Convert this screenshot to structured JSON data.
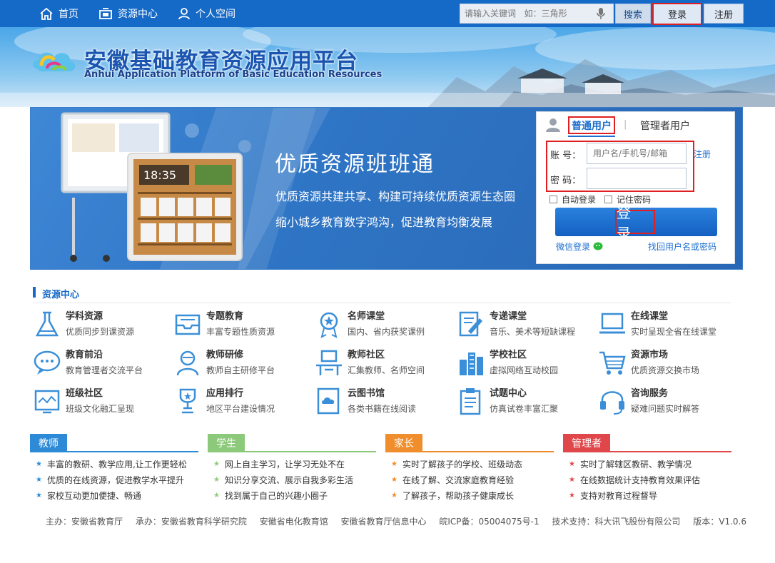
{
  "topnav": {
    "items": [
      {
        "label": "首页",
        "icon": "home-icon"
      },
      {
        "label": "资源中心",
        "icon": "monitor-icon"
      },
      {
        "label": "个人空间",
        "icon": "user-icon"
      }
    ],
    "search_placeholder": "请输入关键词   如：三角形",
    "search_label": "搜索",
    "login_label": "登录",
    "register_label": "注册"
  },
  "banner": {
    "title": "安徽基础教育资源应用平台",
    "subtitle": "Anhui Application Platform of Basic Education Resources"
  },
  "hero": {
    "slogan": "优质资源班班通",
    "line1": "优质资源共建共享、构建可持续优质资源生态圈",
    "line2": "缩小城乡教育数字鸿沟，促进教育均衡发展",
    "clock": "18:35"
  },
  "login": {
    "tab_normal": "普通用户",
    "tab_separator": "|",
    "tab_admin": "管理者用户",
    "account_label": "账  号：",
    "account_placeholder": "用户名/手机号/邮箱",
    "password_label": "密  码：",
    "register_link": "注册",
    "auto_login": "自动登录",
    "remember_pwd": "记住密码",
    "submit": "登 录",
    "wechat_login": "微信登录",
    "forgot": "找回用户名或密码"
  },
  "resource_center": {
    "title": "资源中心",
    "items": [
      {
        "title": "学科资源",
        "desc": "优质同步到课资源",
        "icon": "flask-icon"
      },
      {
        "title": "专题教育",
        "desc": "丰富专题性质资源",
        "icon": "inbox-icon"
      },
      {
        "title": "名师课堂",
        "desc": "国内、省内获奖课例",
        "icon": "medal-icon"
      },
      {
        "title": "专递课堂",
        "desc": "音乐、美术等短缺课程",
        "icon": "edit-icon"
      },
      {
        "title": "在线课堂",
        "desc": "实时呈现全省在线课堂",
        "icon": "laptop-icon"
      },
      {
        "title": "教育前沿",
        "desc": "教育管理者交流平台",
        "icon": "chat-icon"
      },
      {
        "title": "教师研修",
        "desc": "教师自主研修平台",
        "icon": "teacher-icon"
      },
      {
        "title": "教师社区",
        "desc": "汇集教师、名师空间",
        "icon": "desk-icon"
      },
      {
        "title": "学校社区",
        "desc": "虚拟网络互动校园",
        "icon": "buildings-icon"
      },
      {
        "title": "资源市场",
        "desc": "优质资源交换市场",
        "icon": "cart-icon"
      },
      {
        "title": "班级社区",
        "desc": "班级文化融汇呈现",
        "icon": "board-icon"
      },
      {
        "title": "应用排行",
        "desc": "地区平台建设情况",
        "icon": "trophy-icon"
      },
      {
        "title": "云图书馆",
        "desc": "各类书籍在线阅读",
        "icon": "cloud-book-icon"
      },
      {
        "title": "试题中心",
        "desc": "仿真试卷丰富汇聚",
        "icon": "clipboard-icon"
      },
      {
        "title": "咨询服务",
        "desc": "疑难问题实时解答",
        "icon": "headset-icon"
      }
    ]
  },
  "roles": [
    {
      "name": "教师",
      "color": "#2d8ad6",
      "star_color": "#2d8ad6",
      "lines": [
        "丰富的教研、教学应用,让工作更轻松",
        "优质的在线资源，促进教学水平提升",
        "家校互动更加便捷、畅通"
      ]
    },
    {
      "name": "学生",
      "color": "#8cc97a",
      "star_color": "#8cc97a",
      "lines": [
        "网上自主学习，让学习无处不在",
        "知识分享交流、展示自我多彩生活",
        "找到属于自己的兴趣小圈子"
      ]
    },
    {
      "name": "家长",
      "color": "#f08d2c",
      "star_color": "#f08d2c",
      "lines": [
        "实时了解孩子的学校、班级动态",
        "在线了解、交流家庭教育经验",
        "了解孩子，帮助孩子健康成长"
      ]
    },
    {
      "name": "管理者",
      "color": "#e0474a",
      "star_color": "#e0474a",
      "lines": [
        "实时了解辖区教研、教学情况",
        "在线数据统计支持教育效果评估",
        "支持对教育过程督导"
      ]
    }
  ],
  "footer": {
    "host": "主办：安徽省教育厅",
    "organizer": "承办：安徽省教育科学研究院",
    "org2": "安徽省电化教育馆",
    "org3": "安徽省教育厅信息中心",
    "icp": "皖ICP备：05004075号-1",
    "support": "技术支持：科大讯飞股份有限公司",
    "version": "版本：V1.0.6"
  }
}
